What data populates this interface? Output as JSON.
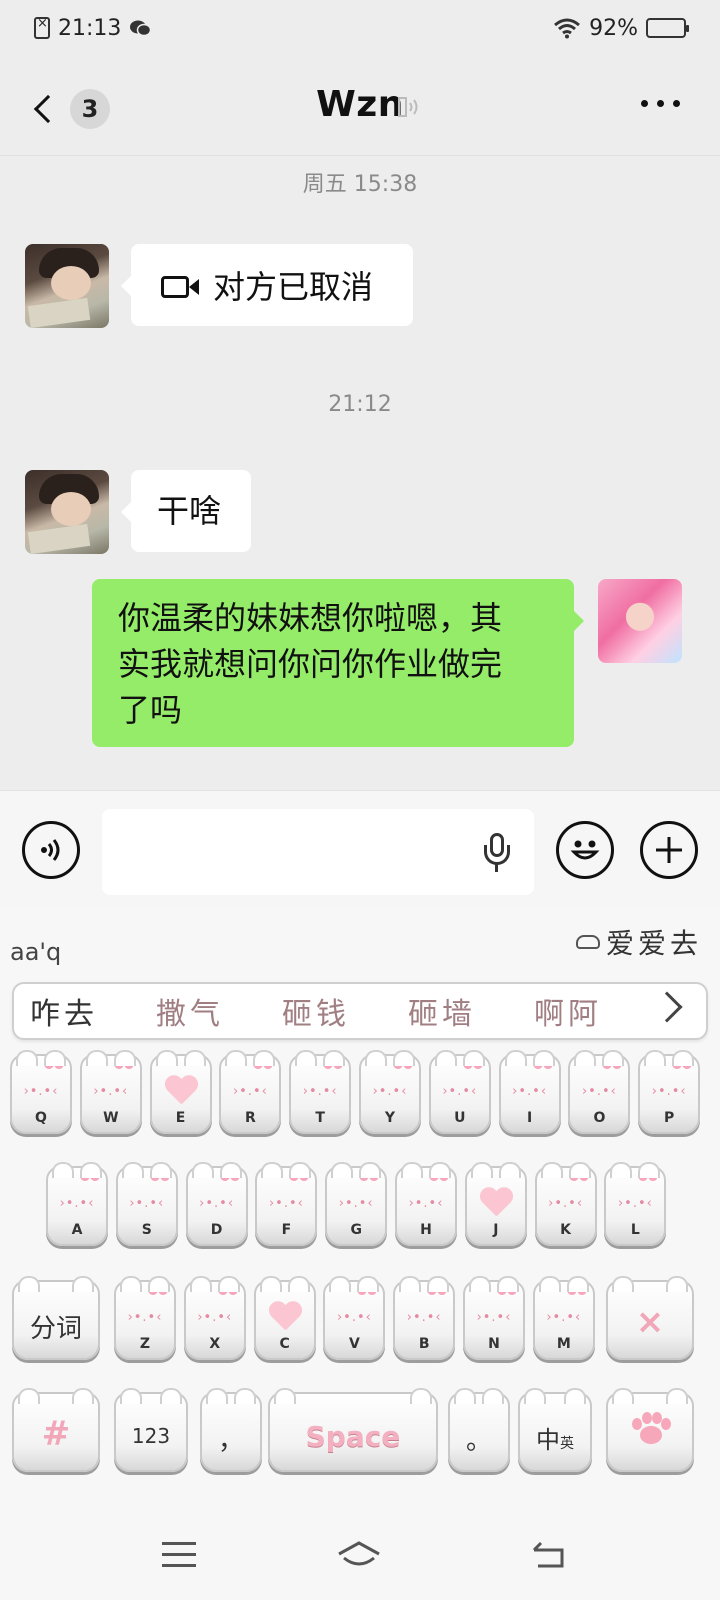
{
  "status_bar": {
    "time": "21:13",
    "battery": "92%",
    "battery_level": 0.92
  },
  "header": {
    "unread_count": "3",
    "contact_name": "Wzn"
  },
  "messages": [
    {
      "type": "timestamp",
      "text": "周五 15:38"
    },
    {
      "type": "incoming",
      "text": "对方已取消",
      "icon": "video-call-icon"
    },
    {
      "type": "timestamp",
      "text": "21:12"
    },
    {
      "type": "incoming",
      "text": "干啥"
    },
    {
      "type": "outgoing",
      "lines": [
        "你温柔的妹妹想你啦嗯，其",
        "实我就想问你问你作业做完",
        "了吗"
      ]
    }
  ],
  "input": {
    "value": "",
    "placeholder": ""
  },
  "keyboard": {
    "composition": "aa'q",
    "cloud_suggestion": "爱爱去",
    "candidates": [
      "咋去",
      "撒气",
      "砸钱",
      "砸墙",
      "啊阿"
    ],
    "row1": [
      "Q",
      "W",
      "E",
      "R",
      "T",
      "Y",
      "U",
      "I",
      "O",
      "P"
    ],
    "row2": [
      "A",
      "S",
      "D",
      "F",
      "G",
      "H",
      "J",
      "K",
      "L"
    ],
    "row3": [
      "Z",
      "X",
      "C",
      "V",
      "B",
      "N",
      "M"
    ],
    "segment_label": "分词",
    "delete_label": "×",
    "symbol_label": "#",
    "number_label": "123",
    "comma_label": "，",
    "space_label": "Space",
    "period_label": "。",
    "lang_label_main": "中",
    "lang_label_alt": "英"
  }
}
